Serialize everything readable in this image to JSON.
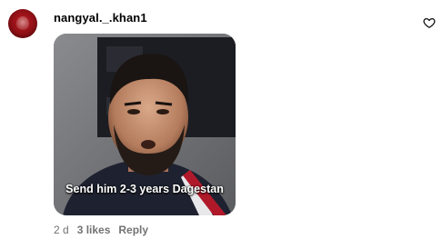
{
  "comment": {
    "username": "nangyal._.khan1",
    "gif_caption": "Send him 2-3 years Dagestan",
    "age": "2 d",
    "likes": "3 likes",
    "reply_label": "Reply"
  },
  "icons": {
    "like": "heart-outline-icon",
    "avatar": "user-avatar"
  },
  "colors": {
    "meta_text": "#737373",
    "avatar": "#c21c24"
  }
}
